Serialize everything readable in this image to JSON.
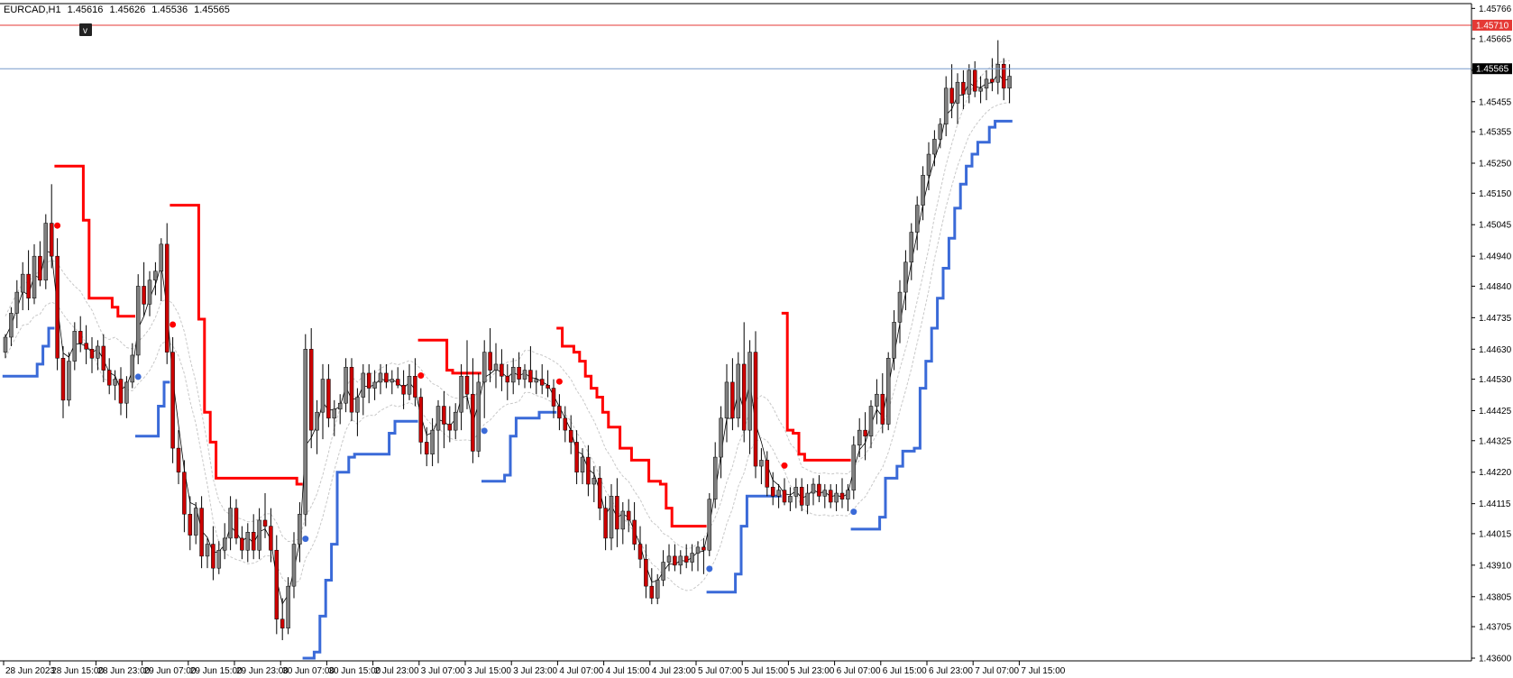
{
  "header": {
    "symbol": "EURCAD,H1",
    "open": "1.45616",
    "high": "1.45626",
    "low": "1.45536",
    "close": "1.45565"
  },
  "colors": {
    "background": "#ffffff",
    "bull_candle": "#808080",
    "bear_candle": "#cc0000",
    "wick": "#000000",
    "resistance_line": "#e53935",
    "current_price_line": "#7799cc",
    "trail_up": "#3a6ad8",
    "trail_down": "#ff0000",
    "envelope": "#c8c8c8",
    "fast_ma": "#000000"
  },
  "icons": {
    "marker_toggle": "v-box-icon",
    "sell_signal": "red-dot-arrow-icon",
    "buy_signal": "blue-dot-arrow-icon"
  },
  "marker_toggle_label": "v",
  "price_tags": {
    "resistance": {
      "value": 1.4571,
      "label": "1.45710",
      "color": "#e53935"
    },
    "current": {
      "value": 1.45565,
      "label": "1.45565",
      "color": "#000000"
    }
  },
  "chart_data": {
    "type": "candlestick",
    "timeframe": "H1",
    "ylim": [
      1.436,
      1.4577
    ],
    "y_ticks": [
      "1.45766",
      "1.45665",
      "1.45560",
      "1.45455",
      "1.45355",
      "1.45250",
      "1.45150",
      "1.45045",
      "1.44940",
      "1.44840",
      "1.44735",
      "1.44630",
      "1.44530",
      "1.44425",
      "1.44325",
      "1.44220",
      "1.44115",
      "1.44015",
      "1.43910",
      "1.43805",
      "1.43705",
      "1.43600"
    ],
    "x_ticks": [
      {
        "label": "28 Jun 2023",
        "bar": 0
      },
      {
        "label": "28 Jun 15:00",
        "bar": 8
      },
      {
        "label": "28 Jun 23:00",
        "bar": 16
      },
      {
        "label": "29 Jun 07:00",
        "bar": 24
      },
      {
        "label": "29 Jun 15:00",
        "bar": 32
      },
      {
        "label": "29 Jun 23:00",
        "bar": 40
      },
      {
        "label": "30 Jun 07:00",
        "bar": 48
      },
      {
        "label": "30 Jun 15:00",
        "bar": 56
      },
      {
        "label": "2 Jul 23:00",
        "bar": 64
      },
      {
        "label": "3 Jul 07:00",
        "bar": 72
      },
      {
        "label": "3 Jul 15:00",
        "bar": 80
      },
      {
        "label": "3 Jul 23:00",
        "bar": 88
      },
      {
        "label": "4 Jul 07:00",
        "bar": 96
      },
      {
        "label": "4 Jul 15:00",
        "bar": 104
      },
      {
        "label": "4 Jul 23:00",
        "bar": 112
      },
      {
        "label": "5 Jul 07:00",
        "bar": 120
      },
      {
        "label": "5 Jul 15:00",
        "bar": 128
      },
      {
        "label": "5 Jul 23:00",
        "bar": 136
      },
      {
        "label": "6 Jul 07:00",
        "bar": 144
      },
      {
        "label": "6 Jul 15:00",
        "bar": 152
      },
      {
        "label": "6 Jul 23:00",
        "bar": 160
      },
      {
        "label": "7 Jul 07:00",
        "bar": 168
      },
      {
        "label": "7 Jul 15:00",
        "bar": 176
      }
    ],
    "candles": [
      [
        1.4462,
        1.4468,
        1.446,
        1.4467
      ],
      [
        1.4467,
        1.4477,
        1.4464,
        1.4475
      ],
      [
        1.4475,
        1.4486,
        1.447,
        1.4482
      ],
      [
        1.4482,
        1.4492,
        1.4476,
        1.4488
      ],
      [
        1.4488,
        1.4496,
        1.4476,
        1.448
      ],
      [
        1.448,
        1.4498,
        1.4478,
        1.4494
      ],
      [
        1.4494,
        1.4499,
        1.4484,
        1.4486
      ],
      [
        1.4486,
        1.4508,
        1.4483,
        1.4505
      ],
      [
        1.4505,
        1.4518,
        1.449,
        1.4494
      ],
      [
        1.4494,
        1.45,
        1.4456,
        1.446
      ],
      [
        1.446,
        1.4464,
        1.444,
        1.4446
      ],
      [
        1.4446,
        1.4462,
        1.4444,
        1.4459
      ],
      [
        1.4459,
        1.4472,
        1.4456,
        1.4469
      ],
      [
        1.4469,
        1.4474,
        1.4462,
        1.4465
      ],
      [
        1.4465,
        1.4471,
        1.4458,
        1.4463
      ],
      [
        1.4463,
        1.4467,
        1.4455,
        1.446
      ],
      [
        1.446,
        1.4466,
        1.4456,
        1.4464
      ],
      [
        1.4464,
        1.4468,
        1.4452,
        1.4456
      ],
      [
        1.4456,
        1.446,
        1.4448,
        1.4451
      ],
      [
        1.4451,
        1.4456,
        1.4446,
        1.4453
      ],
      [
        1.4453,
        1.4457,
        1.4441,
        1.4445
      ],
      [
        1.4445,
        1.4454,
        1.444,
        1.4452
      ],
      [
        1.4452,
        1.4465,
        1.445,
        1.4461
      ],
      [
        1.4461,
        1.4488,
        1.4458,
        1.4484
      ],
      [
        1.4484,
        1.4492,
        1.4474,
        1.4478
      ],
      [
        1.4478,
        1.4489,
        1.4474,
        1.4486
      ],
      [
        1.4486,
        1.4492,
        1.4481,
        1.4489
      ],
      [
        1.4489,
        1.45,
        1.4479,
        1.4498
      ],
      [
        1.4498,
        1.4505,
        1.4458,
        1.4462
      ],
      [
        1.4462,
        1.4467,
        1.4425,
        1.443
      ],
      [
        1.443,
        1.4436,
        1.4418,
        1.4422
      ],
      [
        1.4422,
        1.4426,
        1.4402,
        1.4408
      ],
      [
        1.4408,
        1.4414,
        1.4396,
        1.4401
      ],
      [
        1.4401,
        1.4412,
        1.4398,
        1.441
      ],
      [
        1.441,
        1.4414,
        1.439,
        1.4394
      ],
      [
        1.4394,
        1.44,
        1.439,
        1.4398
      ],
      [
        1.4398,
        1.4404,
        1.4386,
        1.439
      ],
      [
        1.439,
        1.4399,
        1.4388,
        1.4396
      ],
      [
        1.4396,
        1.4405,
        1.4393,
        1.44
      ],
      [
        1.44,
        1.4414,
        1.4396,
        1.441
      ],
      [
        1.441,
        1.4413,
        1.4398,
        1.44
      ],
      [
        1.44,
        1.4404,
        1.4393,
        1.4396
      ],
      [
        1.4396,
        1.4405,
        1.4392,
        1.4402
      ],
      [
        1.4402,
        1.4408,
        1.4393,
        1.4396
      ],
      [
        1.4396,
        1.441,
        1.4393,
        1.4406
      ],
      [
        1.4406,
        1.4415,
        1.44,
        1.4404
      ],
      [
        1.4404,
        1.441,
        1.4392,
        1.4396
      ],
      [
        1.4396,
        1.4401,
        1.4368,
        1.4373
      ],
      [
        1.4373,
        1.438,
        1.4366,
        1.437
      ],
      [
        1.437,
        1.4387,
        1.4368,
        1.4384
      ],
      [
        1.4384,
        1.4402,
        1.438,
        1.4398
      ],
      [
        1.4398,
        1.4412,
        1.4392,
        1.4408
      ],
      [
        1.4408,
        1.4468,
        1.4404,
        1.4463
      ],
      [
        1.4463,
        1.447,
        1.443,
        1.4436
      ],
      [
        1.4436,
        1.4446,
        1.4428,
        1.4442
      ],
      [
        1.4442,
        1.4458,
        1.4433,
        1.4453
      ],
      [
        1.4453,
        1.4458,
        1.4437,
        1.444
      ],
      [
        1.444,
        1.4446,
        1.4434,
        1.4443
      ],
      [
        1.4443,
        1.4448,
        1.4438,
        1.4445
      ],
      [
        1.4445,
        1.446,
        1.4442,
        1.4457
      ],
      [
        1.4457,
        1.446,
        1.4439,
        1.4442
      ],
      [
        1.4442,
        1.445,
        1.4434,
        1.4447
      ],
      [
        1.4447,
        1.4458,
        1.4441,
        1.4455
      ],
      [
        1.4455,
        1.4458,
        1.4445,
        1.445
      ],
      [
        1.445,
        1.4456,
        1.4446,
        1.4452
      ],
      [
        1.4452,
        1.4458,
        1.4448,
        1.4455
      ],
      [
        1.4455,
        1.4458,
        1.445,
        1.4452
      ],
      [
        1.4452,
        1.4456,
        1.4448,
        1.4453
      ],
      [
        1.4453,
        1.4457,
        1.445,
        1.4451
      ],
      [
        1.4451,
        1.4456,
        1.4443,
        1.4448
      ],
      [
        1.4448,
        1.4458,
        1.4446,
        1.4454
      ],
      [
        1.4454,
        1.446,
        1.4444,
        1.4447
      ],
      [
        1.4447,
        1.445,
        1.4428,
        1.4432
      ],
      [
        1.4432,
        1.4437,
        1.4424,
        1.4428
      ],
      [
        1.4428,
        1.444,
        1.4424,
        1.4436
      ],
      [
        1.4436,
        1.4446,
        1.4425,
        1.4444
      ],
      [
        1.4444,
        1.4449,
        1.443,
        1.4438
      ],
      [
        1.4438,
        1.4444,
        1.4432,
        1.4436
      ],
      [
        1.4436,
        1.4445,
        1.4433,
        1.4442
      ],
      [
        1.4442,
        1.4458,
        1.4436,
        1.4454
      ],
      [
        1.4454,
        1.4466,
        1.4443,
        1.4448
      ],
      [
        1.4448,
        1.446,
        1.4425,
        1.4429
      ],
      [
        1.4429,
        1.4455,
        1.4427,
        1.4452
      ],
      [
        1.4452,
        1.4466,
        1.444,
        1.4462
      ],
      [
        1.4462,
        1.447,
        1.4452,
        1.4456
      ],
      [
        1.4456,
        1.4465,
        1.445,
        1.4458
      ],
      [
        1.4458,
        1.4463,
        1.4449,
        1.4454
      ],
      [
        1.4454,
        1.4458,
        1.4446,
        1.4452
      ],
      [
        1.4452,
        1.446,
        1.4448,
        1.4457
      ],
      [
        1.4457,
        1.4462,
        1.4451,
        1.4453
      ],
      [
        1.4453,
        1.4458,
        1.445,
        1.4456
      ],
      [
        1.4456,
        1.4464,
        1.445,
        1.4452
      ],
      [
        1.4452,
        1.4456,
        1.4448,
        1.4453
      ],
      [
        1.4453,
        1.4458,
        1.4448,
        1.4451
      ],
      [
        1.4451,
        1.4456,
        1.4447,
        1.445
      ],
      [
        1.445,
        1.4453,
        1.444,
        1.4444
      ],
      [
        1.4444,
        1.4448,
        1.4436,
        1.444
      ],
      [
        1.444,
        1.4444,
        1.4432,
        1.4436
      ],
      [
        1.4436,
        1.4441,
        1.4428,
        1.4432
      ],
      [
        1.4432,
        1.4436,
        1.4418,
        1.4422
      ],
      [
        1.4422,
        1.443,
        1.4418,
        1.4427
      ],
      [
        1.4427,
        1.4431,
        1.4414,
        1.4418
      ],
      [
        1.4418,
        1.4424,
        1.4412,
        1.442
      ],
      [
        1.442,
        1.4424,
        1.4406,
        1.441
      ],
      [
        1.441,
        1.4414,
        1.4396,
        1.44
      ],
      [
        1.44,
        1.4418,
        1.4396,
        1.4414
      ],
      [
        1.4414,
        1.442,
        1.4397,
        1.4403
      ],
      [
        1.4403,
        1.4412,
        1.4398,
        1.4409
      ],
      [
        1.4409,
        1.4413,
        1.4402,
        1.4406
      ],
      [
        1.4406,
        1.4412,
        1.4396,
        1.4398
      ],
      [
        1.4398,
        1.4404,
        1.439,
        1.4393
      ],
      [
        1.4393,
        1.4398,
        1.438,
        1.4384
      ],
      [
        1.4384,
        1.439,
        1.4378,
        1.438
      ],
      [
        1.438,
        1.4388,
        1.4378,
        1.4386
      ],
      [
        1.4386,
        1.4396,
        1.4384,
        1.4392
      ],
      [
        1.4392,
        1.4398,
        1.4389,
        1.4394
      ],
      [
        1.4394,
        1.4398,
        1.4389,
        1.4391
      ],
      [
        1.4391,
        1.4396,
        1.4388,
        1.4394
      ],
      [
        1.4394,
        1.4398,
        1.439,
        1.4392
      ],
      [
        1.4392,
        1.4398,
        1.4389,
        1.4395
      ],
      [
        1.4395,
        1.4399,
        1.4389,
        1.4397
      ],
      [
        1.4397,
        1.44,
        1.4388,
        1.4396
      ],
      [
        1.4396,
        1.4415,
        1.4394,
        1.4413
      ],
      [
        1.4413,
        1.4432,
        1.441,
        1.4427
      ],
      [
        1.4427,
        1.4444,
        1.442,
        1.444
      ],
      [
        1.444,
        1.4458,
        1.4432,
        1.4452
      ],
      [
        1.4452,
        1.446,
        1.4436,
        1.444
      ],
      [
        1.444,
        1.4462,
        1.4437,
        1.4458
      ],
      [
        1.4458,
        1.4472,
        1.4432,
        1.4436
      ],
      [
        1.4436,
        1.4466,
        1.4428,
        1.4462
      ],
      [
        1.4462,
        1.4469,
        1.442,
        1.4424
      ],
      [
        1.4424,
        1.443,
        1.4418,
        1.4426
      ],
      [
        1.4426,
        1.4429,
        1.4414,
        1.4417
      ],
      [
        1.4417,
        1.4422,
        1.4411,
        1.4414
      ],
      [
        1.4414,
        1.4418,
        1.441,
        1.4416
      ],
      [
        1.4416,
        1.442,
        1.4411,
        1.4412
      ],
      [
        1.4412,
        1.4417,
        1.4409,
        1.4414
      ],
      [
        1.4414,
        1.442,
        1.441,
        1.4417
      ],
      [
        1.4417,
        1.442,
        1.4409,
        1.4411
      ],
      [
        1.4411,
        1.4418,
        1.4408,
        1.4415
      ],
      [
        1.4415,
        1.442,
        1.4411,
        1.4418
      ],
      [
        1.4418,
        1.4421,
        1.4412,
        1.4414
      ],
      [
        1.4414,
        1.4418,
        1.441,
        1.4416
      ],
      [
        1.4416,
        1.4418,
        1.441,
        1.4412
      ],
      [
        1.4412,
        1.4418,
        1.4409,
        1.4415
      ],
      [
        1.4415,
        1.442,
        1.441,
        1.4413
      ],
      [
        1.4413,
        1.4418,
        1.4409,
        1.4416
      ],
      [
        1.4416,
        1.4434,
        1.4413,
        1.4431
      ],
      [
        1.4431,
        1.444,
        1.4427,
        1.4436
      ],
      [
        1.4436,
        1.4442,
        1.4426,
        1.4434
      ],
      [
        1.4434,
        1.4446,
        1.443,
        1.4444
      ],
      [
        1.4444,
        1.4453,
        1.4438,
        1.4448
      ],
      [
        1.4448,
        1.4455,
        1.4435,
        1.4438
      ],
      [
        1.4438,
        1.4462,
        1.4436,
        1.446
      ],
      [
        1.446,
        1.4476,
        1.4456,
        1.4472
      ],
      [
        1.4472,
        1.4486,
        1.4465,
        1.4482
      ],
      [
        1.4482,
        1.4496,
        1.4476,
        1.4492
      ],
      [
        1.4492,
        1.4505,
        1.4486,
        1.4502
      ],
      [
        1.4502,
        1.4514,
        1.4496,
        1.4511
      ],
      [
        1.4511,
        1.4524,
        1.4506,
        1.4521
      ],
      [
        1.4521,
        1.4532,
        1.4516,
        1.4528
      ],
      [
        1.4528,
        1.4536,
        1.4524,
        1.4533
      ],
      [
        1.4533,
        1.454,
        1.453,
        1.4538
      ],
      [
        1.4538,
        1.4554,
        1.4534,
        1.455
      ],
      [
        1.455,
        1.4558,
        1.454,
        1.4545
      ],
      [
        1.4545,
        1.4555,
        1.4538,
        1.4552
      ],
      [
        1.4552,
        1.4556,
        1.4543,
        1.4548
      ],
      [
        1.4548,
        1.4558,
        1.4545,
        1.4556
      ],
      [
        1.4556,
        1.4559,
        1.4547,
        1.4549
      ],
      [
        1.4549,
        1.4554,
        1.4545,
        1.455
      ],
      [
        1.455,
        1.4556,
        1.4546,
        1.4553
      ],
      [
        1.4553,
        1.456,
        1.4549,
        1.4552
      ],
      [
        1.4552,
        1.4566,
        1.4548,
        1.4558
      ],
      [
        1.4558,
        1.456,
        1.4546,
        1.455
      ],
      [
        1.455,
        1.4558,
        1.4545,
        1.4554
      ]
    ]
  }
}
